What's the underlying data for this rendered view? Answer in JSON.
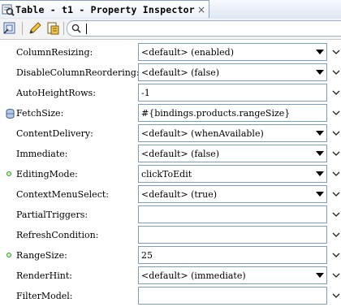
{
  "window": {
    "title": "Table - t1 - Property Inspector",
    "close_glyph": "×"
  },
  "toolbar": {
    "buttons": [
      {
        "icon": "bind-icon"
      },
      {
        "icon": "pencil-icon"
      },
      {
        "icon": "page-icon"
      }
    ],
    "search": {
      "placeholder": "",
      "value": "",
      "icon": "search-icon"
    }
  },
  "properties": [
    {
      "label": "ColumnResizing:",
      "value": "<default> (enabled)",
      "type": "combo",
      "marker": "none"
    },
    {
      "label": "DisableColumnReordering:",
      "value": "<default> (false)",
      "type": "combo",
      "marker": "none"
    },
    {
      "label": "AutoHeightRows:",
      "value": "-1",
      "type": "text",
      "marker": "none"
    },
    {
      "label": "FetchSize:",
      "value": "#{bindings.products.rangeSize}",
      "type": "text",
      "marker": "binding"
    },
    {
      "label": "ContentDelivery:",
      "value": "<default> (whenAvailable)",
      "type": "combo",
      "marker": "none"
    },
    {
      "label": "Immediate:",
      "value": "<default> (false)",
      "type": "combo",
      "marker": "none"
    },
    {
      "label": "EditingMode:",
      "value": "clickToEdit",
      "type": "combo",
      "marker": "set"
    },
    {
      "label": "ContextMenuSelect:",
      "value": "<default> (true)",
      "type": "combo",
      "marker": "none"
    },
    {
      "label": "PartialTriggers:",
      "value": "",
      "type": "text",
      "marker": "none"
    },
    {
      "label": "RefreshCondition:",
      "value": "",
      "type": "text",
      "marker": "none"
    },
    {
      "label": "RangeSize:",
      "value": "25",
      "type": "text",
      "marker": "set"
    },
    {
      "label": "RenderHint:",
      "value": "<default> (immediate)",
      "type": "combo",
      "marker": "none"
    },
    {
      "label": "FilterModel:",
      "value": "",
      "type": "text",
      "marker": "none"
    }
  ],
  "colors": {
    "field_border": "#7f9db9",
    "set_marker": "#3a9a3a",
    "tab_border": "#8ea3bf"
  }
}
